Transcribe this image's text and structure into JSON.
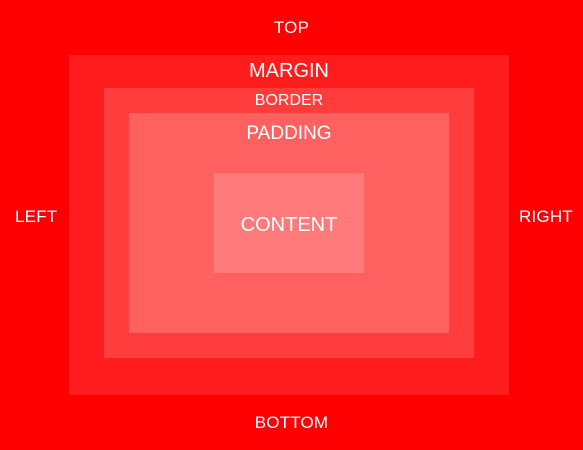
{
  "colors": {
    "background": "#ff0000",
    "margin": "#ff1c1c",
    "border": "#ff3d3d",
    "padding": "#ff6161",
    "content": "#ff7b7b",
    "text": "#ffffff"
  },
  "sides": {
    "top": "TOP",
    "bottom": "BOTTOM",
    "left": "LEFT",
    "right": "RIGHT"
  },
  "boxes": {
    "margin": "MARGIN",
    "border": "BORDER",
    "padding": "PADDING",
    "content": "CONTENT"
  }
}
